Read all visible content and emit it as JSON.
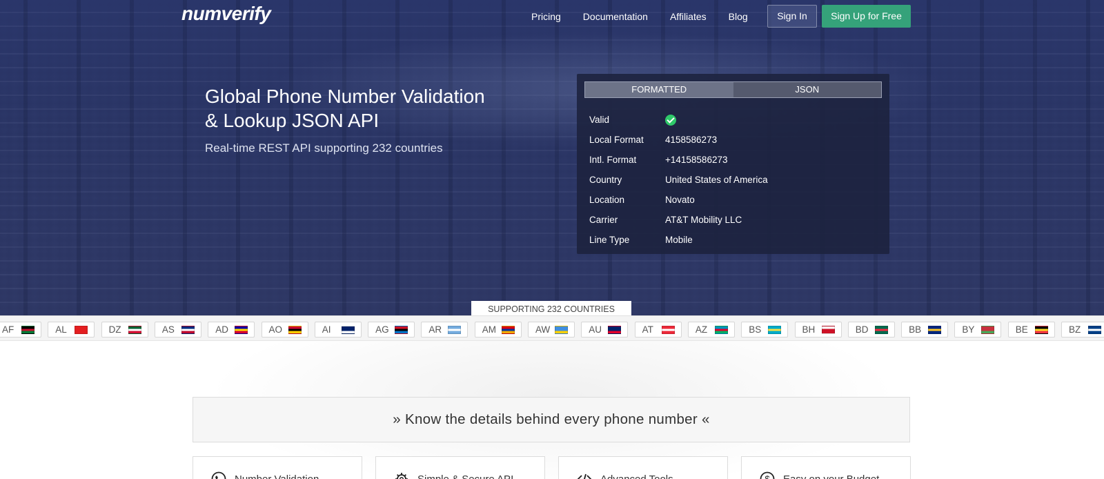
{
  "brand": {
    "logo": "numverify"
  },
  "nav": {
    "links": [
      "Pricing",
      "Documentation",
      "Affiliates",
      "Blog"
    ],
    "signin": "Sign In",
    "signup": "Sign Up for Free"
  },
  "hero": {
    "title": "Global Phone Number Validation & Lookup JSON API",
    "subtitle": "Real-time REST API supporting 232 countries"
  },
  "demo": {
    "tabs": [
      "FORMATTED",
      "JSON"
    ],
    "active_tab": "FORMATTED",
    "rows": [
      {
        "key": "Valid",
        "value": ""
      },
      {
        "key": "Local Format",
        "value": "4158586273"
      },
      {
        "key": "Intl. Format",
        "value": "+14158586273"
      },
      {
        "key": "Country",
        "value": "United States of America"
      },
      {
        "key": "Location",
        "value": "Novato"
      },
      {
        "key": "Carrier",
        "value": "AT&T Mobility LLC"
      },
      {
        "key": "Line Type",
        "value": "Mobile"
      }
    ]
  },
  "countries": {
    "label": "SUPPORTING 232 COUNTRIES",
    "items": [
      {
        "code": "AF",
        "colors": [
          "#000000",
          "#c8102e",
          "#007a36"
        ]
      },
      {
        "code": "AL",
        "colors": [
          "#e41e20",
          "#e41e20",
          "#e41e20"
        ]
      },
      {
        "code": "DZ",
        "colors": [
          "#006233",
          "#ffffff",
          "#d21034"
        ]
      },
      {
        "code": "AS",
        "colors": [
          "#002b7f",
          "#ffffff",
          "#bf0a30"
        ]
      },
      {
        "code": "AD",
        "colors": [
          "#10069f",
          "#fedd00",
          "#d50032"
        ]
      },
      {
        "code": "AO",
        "colors": [
          "#cc092f",
          "#000000",
          "#ffcb00"
        ]
      },
      {
        "code": "AI",
        "colors": [
          "#012169",
          "#012169",
          "#ffffff"
        ]
      },
      {
        "code": "AG",
        "colors": [
          "#ce1126",
          "#000000",
          "#0072c6"
        ]
      },
      {
        "code": "AR",
        "colors": [
          "#74acdf",
          "#ffffff",
          "#74acdf"
        ]
      },
      {
        "code": "AM",
        "colors": [
          "#d90012",
          "#0033a0",
          "#f2a800"
        ]
      },
      {
        "code": "AW",
        "colors": [
          "#418fde",
          "#418fde",
          "#ffd100"
        ]
      },
      {
        "code": "AU",
        "colors": [
          "#012169",
          "#012169",
          "#e4002b"
        ]
      },
      {
        "code": "AT",
        "colors": [
          "#ed2939",
          "#ffffff",
          "#ed2939"
        ]
      },
      {
        "code": "AZ",
        "colors": [
          "#0092bc",
          "#e4002b",
          "#00af66"
        ]
      },
      {
        "code": "BS",
        "colors": [
          "#00abc9",
          "#fae042",
          "#00abc9"
        ]
      },
      {
        "code": "BH",
        "colors": [
          "#ffffff",
          "#ce1126",
          "#ce1126"
        ]
      },
      {
        "code": "BD",
        "colors": [
          "#006a4e",
          "#f42a41",
          "#006a4e"
        ]
      },
      {
        "code": "BB",
        "colors": [
          "#00267f",
          "#ffc726",
          "#00267f"
        ]
      },
      {
        "code": "BY",
        "colors": [
          "#c8313e",
          "#c8313e",
          "#4aa657"
        ]
      },
      {
        "code": "BE",
        "colors": [
          "#000000",
          "#fdda24",
          "#ef3340"
        ]
      },
      {
        "code": "BZ",
        "colors": [
          "#003f87",
          "#ffffff",
          "#003f87"
        ]
      }
    ]
  },
  "tagline": "» Know the details behind every phone number «",
  "features": [
    {
      "icon": "phone-icon",
      "label": "Number Validation"
    },
    {
      "icon": "gear-icon",
      "label": "Simple & Secure API"
    },
    {
      "icon": "code-icon",
      "label": "Advanced Tools"
    },
    {
      "icon": "dollar-icon",
      "label": "Easy on your Budget"
    }
  ],
  "colors": {
    "accent": "#35a27a",
    "hero": "#2c386e",
    "check": "#2fc96a"
  }
}
